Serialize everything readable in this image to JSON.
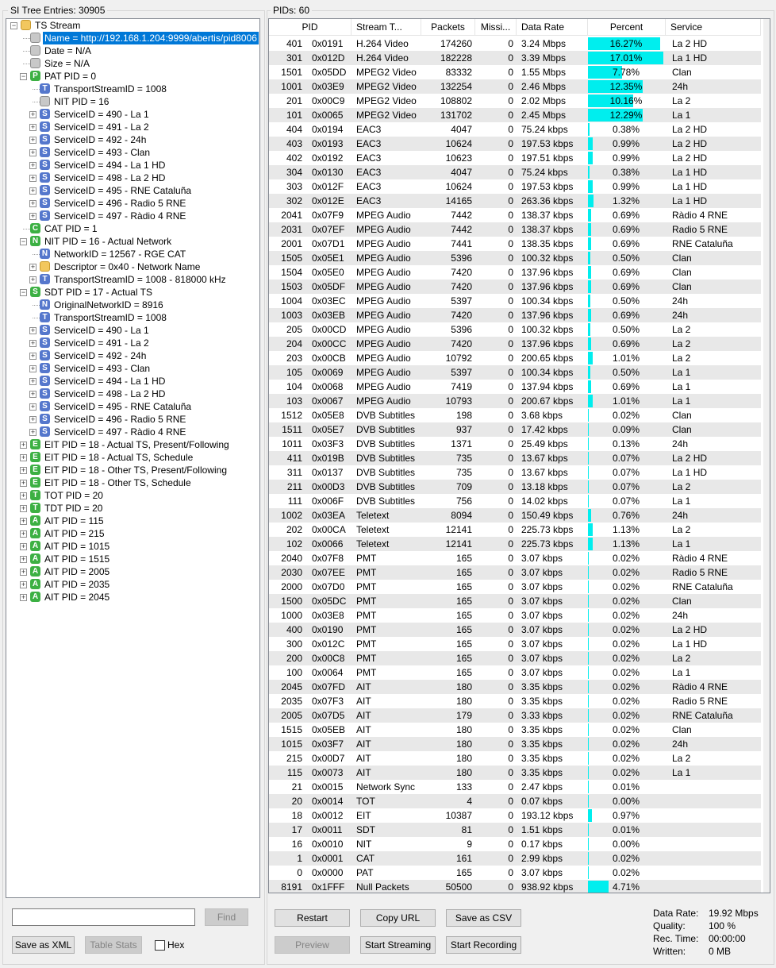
{
  "left_group_label": "SI Tree Entries: 30905",
  "right_group_label": "PIDs: 60",
  "tree": [
    {
      "depth": 0,
      "exp": "-",
      "icon": "",
      "color": "#f2c75e",
      "label": "TS Stream"
    },
    {
      "depth": 1,
      "exp": "",
      "icon": "",
      "color": "#c8c8c8",
      "label": "Name = http://192.168.1.204:9999/abertis/pid8006",
      "selected": true
    },
    {
      "depth": 1,
      "exp": "",
      "icon": "",
      "color": "#c8c8c8",
      "label": "Date = N/A"
    },
    {
      "depth": 1,
      "exp": "",
      "icon": "",
      "color": "#c8c8c8",
      "label": "Size = N/A"
    },
    {
      "depth": 1,
      "exp": "-",
      "icon": "P",
      "color": "#3cb043",
      "label": "PAT PID = 0"
    },
    {
      "depth": 2,
      "exp": "",
      "icon": "T",
      "color": "#5577cc",
      "label": "TransportStreamID = 1008"
    },
    {
      "depth": 2,
      "exp": "",
      "icon": "",
      "color": "#c8c8c8",
      "label": "NIT PID = 16"
    },
    {
      "depth": 2,
      "exp": "+",
      "icon": "S",
      "color": "#5577cc",
      "label": "ServiceID = 490 - La 1"
    },
    {
      "depth": 2,
      "exp": "+",
      "icon": "S",
      "color": "#5577cc",
      "label": "ServiceID = 491 - La 2"
    },
    {
      "depth": 2,
      "exp": "+",
      "icon": "S",
      "color": "#5577cc",
      "label": "ServiceID = 492 - 24h"
    },
    {
      "depth": 2,
      "exp": "+",
      "icon": "S",
      "color": "#5577cc",
      "label": "ServiceID = 493 - Clan"
    },
    {
      "depth": 2,
      "exp": "+",
      "icon": "S",
      "color": "#5577cc",
      "label": "ServiceID = 494 - La 1 HD"
    },
    {
      "depth": 2,
      "exp": "+",
      "icon": "S",
      "color": "#5577cc",
      "label": "ServiceID = 498 - La 2 HD"
    },
    {
      "depth": 2,
      "exp": "+",
      "icon": "S",
      "color": "#5577cc",
      "label": "ServiceID = 495 - RNE Cataluña"
    },
    {
      "depth": 2,
      "exp": "+",
      "icon": "S",
      "color": "#5577cc",
      "label": "ServiceID = 496 - Radio 5 RNE"
    },
    {
      "depth": 2,
      "exp": "+",
      "icon": "S",
      "color": "#5577cc",
      "label": "ServiceID = 497 - Ràdio 4 RNE"
    },
    {
      "depth": 1,
      "exp": "",
      "icon": "C",
      "color": "#3cb043",
      "label": "CAT PID = 1"
    },
    {
      "depth": 1,
      "exp": "-",
      "icon": "N",
      "color": "#3cb043",
      "label": "NIT PID = 16 - Actual Network"
    },
    {
      "depth": 2,
      "exp": "",
      "icon": "N",
      "color": "#5577cc",
      "label": "NetworkID = 12567 - RGE CAT"
    },
    {
      "depth": 2,
      "exp": "+",
      "icon": "",
      "color": "#f2c75e",
      "label": "Descriptor = 0x40 - Network Name"
    },
    {
      "depth": 2,
      "exp": "+",
      "icon": "T",
      "color": "#5577cc",
      "label": "TransportStreamID = 1008 - 818000 kHz"
    },
    {
      "depth": 1,
      "exp": "-",
      "icon": "S",
      "color": "#3cb043",
      "label": "SDT PID = 17 - Actual TS"
    },
    {
      "depth": 2,
      "exp": "",
      "icon": "N",
      "color": "#5577cc",
      "label": "OriginalNetworkID = 8916"
    },
    {
      "depth": 2,
      "exp": "",
      "icon": "T",
      "color": "#5577cc",
      "label": "TransportStreamID = 1008"
    },
    {
      "depth": 2,
      "exp": "+",
      "icon": "S",
      "color": "#5577cc",
      "label": "ServiceID = 490 - La 1"
    },
    {
      "depth": 2,
      "exp": "+",
      "icon": "S",
      "color": "#5577cc",
      "label": "ServiceID = 491 - La 2"
    },
    {
      "depth": 2,
      "exp": "+",
      "icon": "S",
      "color": "#5577cc",
      "label": "ServiceID = 492 - 24h"
    },
    {
      "depth": 2,
      "exp": "+",
      "icon": "S",
      "color": "#5577cc",
      "label": "ServiceID = 493 - Clan"
    },
    {
      "depth": 2,
      "exp": "+",
      "icon": "S",
      "color": "#5577cc",
      "label": "ServiceID = 494 - La 1 HD"
    },
    {
      "depth": 2,
      "exp": "+",
      "icon": "S",
      "color": "#5577cc",
      "label": "ServiceID = 498 - La 2 HD"
    },
    {
      "depth": 2,
      "exp": "+",
      "icon": "S",
      "color": "#5577cc",
      "label": "ServiceID = 495 - RNE Cataluña"
    },
    {
      "depth": 2,
      "exp": "+",
      "icon": "S",
      "color": "#5577cc",
      "label": "ServiceID = 496 - Radio 5 RNE"
    },
    {
      "depth": 2,
      "exp": "+",
      "icon": "S",
      "color": "#5577cc",
      "label": "ServiceID = 497 - Ràdio 4 RNE"
    },
    {
      "depth": 1,
      "exp": "+",
      "icon": "E",
      "color": "#3cb043",
      "label": "EIT PID = 18 - Actual TS, Present/Following"
    },
    {
      "depth": 1,
      "exp": "+",
      "icon": "E",
      "color": "#3cb043",
      "label": "EIT PID = 18 - Actual TS, Schedule"
    },
    {
      "depth": 1,
      "exp": "+",
      "icon": "E",
      "color": "#3cb043",
      "label": "EIT PID = 18 - Other TS, Present/Following"
    },
    {
      "depth": 1,
      "exp": "+",
      "icon": "E",
      "color": "#3cb043",
      "label": "EIT PID = 18 - Other TS, Schedule"
    },
    {
      "depth": 1,
      "exp": "+",
      "icon": "T",
      "color": "#3cb043",
      "label": "TOT PID = 20"
    },
    {
      "depth": 1,
      "exp": "+",
      "icon": "T",
      "color": "#3cb043",
      "label": "TDT PID = 20"
    },
    {
      "depth": 1,
      "exp": "+",
      "icon": "A",
      "color": "#3cb043",
      "label": "AIT PID = 115"
    },
    {
      "depth": 1,
      "exp": "+",
      "icon": "A",
      "color": "#3cb043",
      "label": "AIT PID = 215"
    },
    {
      "depth": 1,
      "exp": "+",
      "icon": "A",
      "color": "#3cb043",
      "label": "AIT PID = 1015"
    },
    {
      "depth": 1,
      "exp": "+",
      "icon": "A",
      "color": "#3cb043",
      "label": "AIT PID = 1515"
    },
    {
      "depth": 1,
      "exp": "+",
      "icon": "A",
      "color": "#3cb043",
      "label": "AIT PID = 2005"
    },
    {
      "depth": 1,
      "exp": "+",
      "icon": "A",
      "color": "#3cb043",
      "label": "AIT PID = 2035"
    },
    {
      "depth": 1,
      "exp": "+",
      "icon": "A",
      "color": "#3cb043",
      "label": "AIT PID = 2045"
    }
  ],
  "columns": [
    "PID",
    "Stream T...",
    "Packets",
    "Missi...",
    "Data Rate",
    "Percent",
    "Service"
  ],
  "rows": [
    [
      "401",
      "0x0191",
      "H.264 Video",
      "174260",
      "0",
      "3.24 Mbps",
      16.27,
      "16.27%",
      "La 2 HD"
    ],
    [
      "301",
      "0x012D",
      "H.264 Video",
      "182228",
      "0",
      "3.39 Mbps",
      17.01,
      "17.01%",
      "La 1 HD"
    ],
    [
      "1501",
      "0x05DD",
      "MPEG2 Video",
      "83332",
      "0",
      "1.55 Mbps",
      7.78,
      "7.78%",
      "Clan"
    ],
    [
      "1001",
      "0x03E9",
      "MPEG2 Video",
      "132254",
      "0",
      "2.46 Mbps",
      12.35,
      "12.35%",
      "24h"
    ],
    [
      "201",
      "0x00C9",
      "MPEG2 Video",
      "108802",
      "0",
      "2.02 Mbps",
      10.16,
      "10.16%",
      "La 2"
    ],
    [
      "101",
      "0x0065",
      "MPEG2 Video",
      "131702",
      "0",
      "2.45 Mbps",
      12.29,
      "12.29%",
      "La 1"
    ],
    [
      "404",
      "0x0194",
      "EAC3",
      "4047",
      "0",
      "75.24 kbps",
      0.38,
      "0.38%",
      "La 2 HD"
    ],
    [
      "403",
      "0x0193",
      "EAC3",
      "10624",
      "0",
      "197.53 kbps",
      0.99,
      "0.99%",
      "La 2 HD"
    ],
    [
      "402",
      "0x0192",
      "EAC3",
      "10623",
      "0",
      "197.51 kbps",
      0.99,
      "0.99%",
      "La 2 HD"
    ],
    [
      "304",
      "0x0130",
      "EAC3",
      "4047",
      "0",
      "75.24 kbps",
      0.38,
      "0.38%",
      "La 1 HD"
    ],
    [
      "303",
      "0x012F",
      "EAC3",
      "10624",
      "0",
      "197.53 kbps",
      0.99,
      "0.99%",
      "La 1 HD"
    ],
    [
      "302",
      "0x012E",
      "EAC3",
      "14165",
      "0",
      "263.36 kbps",
      1.32,
      "1.32%",
      "La 1 HD"
    ],
    [
      "2041",
      "0x07F9",
      "MPEG Audio",
      "7442",
      "0",
      "138.37 kbps",
      0.69,
      "0.69%",
      "Ràdio 4 RNE"
    ],
    [
      "2031",
      "0x07EF",
      "MPEG Audio",
      "7442",
      "0",
      "138.37 kbps",
      0.69,
      "0.69%",
      "Radio 5 RNE"
    ],
    [
      "2001",
      "0x07D1",
      "MPEG Audio",
      "7441",
      "0",
      "138.35 kbps",
      0.69,
      "0.69%",
      "RNE Cataluña"
    ],
    [
      "1505",
      "0x05E1",
      "MPEG Audio",
      "5396",
      "0",
      "100.32 kbps",
      0.5,
      "0.50%",
      "Clan"
    ],
    [
      "1504",
      "0x05E0",
      "MPEG Audio",
      "7420",
      "0",
      "137.96 kbps",
      0.69,
      "0.69%",
      "Clan"
    ],
    [
      "1503",
      "0x05DF",
      "MPEG Audio",
      "7420",
      "0",
      "137.96 kbps",
      0.69,
      "0.69%",
      "Clan"
    ],
    [
      "1004",
      "0x03EC",
      "MPEG Audio",
      "5397",
      "0",
      "100.34 kbps",
      0.5,
      "0.50%",
      "24h"
    ],
    [
      "1003",
      "0x03EB",
      "MPEG Audio",
      "7420",
      "0",
      "137.96 kbps",
      0.69,
      "0.69%",
      "24h"
    ],
    [
      "205",
      "0x00CD",
      "MPEG Audio",
      "5396",
      "0",
      "100.32 kbps",
      0.5,
      "0.50%",
      "La 2"
    ],
    [
      "204",
      "0x00CC",
      "MPEG Audio",
      "7420",
      "0",
      "137.96 kbps",
      0.69,
      "0.69%",
      "La 2"
    ],
    [
      "203",
      "0x00CB",
      "MPEG Audio",
      "10792",
      "0",
      "200.65 kbps",
      1.01,
      "1.01%",
      "La 2"
    ],
    [
      "105",
      "0x0069",
      "MPEG Audio",
      "5397",
      "0",
      "100.34 kbps",
      0.5,
      "0.50%",
      "La 1"
    ],
    [
      "104",
      "0x0068",
      "MPEG Audio",
      "7419",
      "0",
      "137.94 kbps",
      0.69,
      "0.69%",
      "La 1"
    ],
    [
      "103",
      "0x0067",
      "MPEG Audio",
      "10793",
      "0",
      "200.67 kbps",
      1.01,
      "1.01%",
      "La 1"
    ],
    [
      "1512",
      "0x05E8",
      "DVB Subtitles",
      "198",
      "0",
      "3.68 kbps",
      0.02,
      "0.02%",
      "Clan"
    ],
    [
      "1511",
      "0x05E7",
      "DVB Subtitles",
      "937",
      "0",
      "17.42 kbps",
      0.09,
      "0.09%",
      "Clan"
    ],
    [
      "1011",
      "0x03F3",
      "DVB Subtitles",
      "1371",
      "0",
      "25.49 kbps",
      0.13,
      "0.13%",
      "24h"
    ],
    [
      "411",
      "0x019B",
      "DVB Subtitles",
      "735",
      "0",
      "13.67 kbps",
      0.07,
      "0.07%",
      "La 2 HD"
    ],
    [
      "311",
      "0x0137",
      "DVB Subtitles",
      "735",
      "0",
      "13.67 kbps",
      0.07,
      "0.07%",
      "La 1 HD"
    ],
    [
      "211",
      "0x00D3",
      "DVB Subtitles",
      "709",
      "0",
      "13.18 kbps",
      0.07,
      "0.07%",
      "La 2"
    ],
    [
      "111",
      "0x006F",
      "DVB Subtitles",
      "756",
      "0",
      "14.02 kbps",
      0.07,
      "0.07%",
      "La 1"
    ],
    [
      "1002",
      "0x03EA",
      "Teletext",
      "8094",
      "0",
      "150.49 kbps",
      0.76,
      "0.76%",
      "24h"
    ],
    [
      "202",
      "0x00CA",
      "Teletext",
      "12141",
      "0",
      "225.73 kbps",
      1.13,
      "1.13%",
      "La 2"
    ],
    [
      "102",
      "0x0066",
      "Teletext",
      "12141",
      "0",
      "225.73 kbps",
      1.13,
      "1.13%",
      "La 1"
    ],
    [
      "2040",
      "0x07F8",
      "PMT",
      "165",
      "0",
      "3.07 kbps",
      0.02,
      "0.02%",
      "Ràdio 4 RNE"
    ],
    [
      "2030",
      "0x07EE",
      "PMT",
      "165",
      "0",
      "3.07 kbps",
      0.02,
      "0.02%",
      "Radio 5 RNE"
    ],
    [
      "2000",
      "0x07D0",
      "PMT",
      "165",
      "0",
      "3.07 kbps",
      0.02,
      "0.02%",
      "RNE Cataluña"
    ],
    [
      "1500",
      "0x05DC",
      "PMT",
      "165",
      "0",
      "3.07 kbps",
      0.02,
      "0.02%",
      "Clan"
    ],
    [
      "1000",
      "0x03E8",
      "PMT",
      "165",
      "0",
      "3.07 kbps",
      0.02,
      "0.02%",
      "24h"
    ],
    [
      "400",
      "0x0190",
      "PMT",
      "165",
      "0",
      "3.07 kbps",
      0.02,
      "0.02%",
      "La 2 HD"
    ],
    [
      "300",
      "0x012C",
      "PMT",
      "165",
      "0",
      "3.07 kbps",
      0.02,
      "0.02%",
      "La 1 HD"
    ],
    [
      "200",
      "0x00C8",
      "PMT",
      "165",
      "0",
      "3.07 kbps",
      0.02,
      "0.02%",
      "La 2"
    ],
    [
      "100",
      "0x0064",
      "PMT",
      "165",
      "0",
      "3.07 kbps",
      0.02,
      "0.02%",
      "La 1"
    ],
    [
      "2045",
      "0x07FD",
      "AIT",
      "180",
      "0",
      "3.35 kbps",
      0.02,
      "0.02%",
      "Ràdio 4 RNE"
    ],
    [
      "2035",
      "0x07F3",
      "AIT",
      "180",
      "0",
      "3.35 kbps",
      0.02,
      "0.02%",
      "Radio 5 RNE"
    ],
    [
      "2005",
      "0x07D5",
      "AIT",
      "179",
      "0",
      "3.33 kbps",
      0.02,
      "0.02%",
      "RNE Cataluña"
    ],
    [
      "1515",
      "0x05EB",
      "AIT",
      "180",
      "0",
      "3.35 kbps",
      0.02,
      "0.02%",
      "Clan"
    ],
    [
      "1015",
      "0x03F7",
      "AIT",
      "180",
      "0",
      "3.35 kbps",
      0.02,
      "0.02%",
      "24h"
    ],
    [
      "215",
      "0x00D7",
      "AIT",
      "180",
      "0",
      "3.35 kbps",
      0.02,
      "0.02%",
      "La 2"
    ],
    [
      "115",
      "0x0073",
      "AIT",
      "180",
      "0",
      "3.35 kbps",
      0.02,
      "0.02%",
      "La 1"
    ],
    [
      "21",
      "0x0015",
      "Network Sync",
      "133",
      "0",
      "2.47 kbps",
      0.01,
      "0.01%",
      ""
    ],
    [
      "20",
      "0x0014",
      "TOT",
      "4",
      "0",
      "0.07 kbps",
      0.0,
      "0.00%",
      ""
    ],
    [
      "18",
      "0x0012",
      "EIT",
      "10387",
      "0",
      "193.12 kbps",
      0.97,
      "0.97%",
      ""
    ],
    [
      "17",
      "0x0011",
      "SDT",
      "81",
      "0",
      "1.51 kbps",
      0.01,
      "0.01%",
      ""
    ],
    [
      "16",
      "0x0010",
      "NIT",
      "9",
      "0",
      "0.17 kbps",
      0.0,
      "0.00%",
      ""
    ],
    [
      "1",
      "0x0001",
      "CAT",
      "161",
      "0",
      "2.99 kbps",
      0.02,
      "0.02%",
      ""
    ],
    [
      "0",
      "0x0000",
      "PAT",
      "165",
      "0",
      "3.07 kbps",
      0.02,
      "0.02%",
      ""
    ],
    [
      "8191",
      "0x1FFF",
      "Null Packets",
      "50500",
      "0",
      "938.92 kbps",
      4.71,
      "4.71%",
      ""
    ]
  ],
  "search": {
    "value": "",
    "find_label": "Find"
  },
  "buttons": {
    "save_xml": "Save as XML",
    "table_stats": "Table Stats",
    "hex": "Hex",
    "restart": "Restart",
    "copy_url": "Copy URL",
    "save_csv": "Save as CSV",
    "preview": "Preview",
    "start_streaming": "Start Streaming",
    "start_recording": "Start Recording"
  },
  "stats": {
    "data_rate_label": "Data Rate:",
    "data_rate": "19.92 Mbps",
    "quality_label": "Quality:",
    "quality": "100 %",
    "rec_time_label": "Rec. Time:",
    "rec_time": "00:00:00",
    "written_label": "Written:",
    "written": "0 MB"
  },
  "colors": {
    "accent": "#0078d7",
    "bar": "#00eeee",
    "alt_row": "#e8e8e8"
  }
}
